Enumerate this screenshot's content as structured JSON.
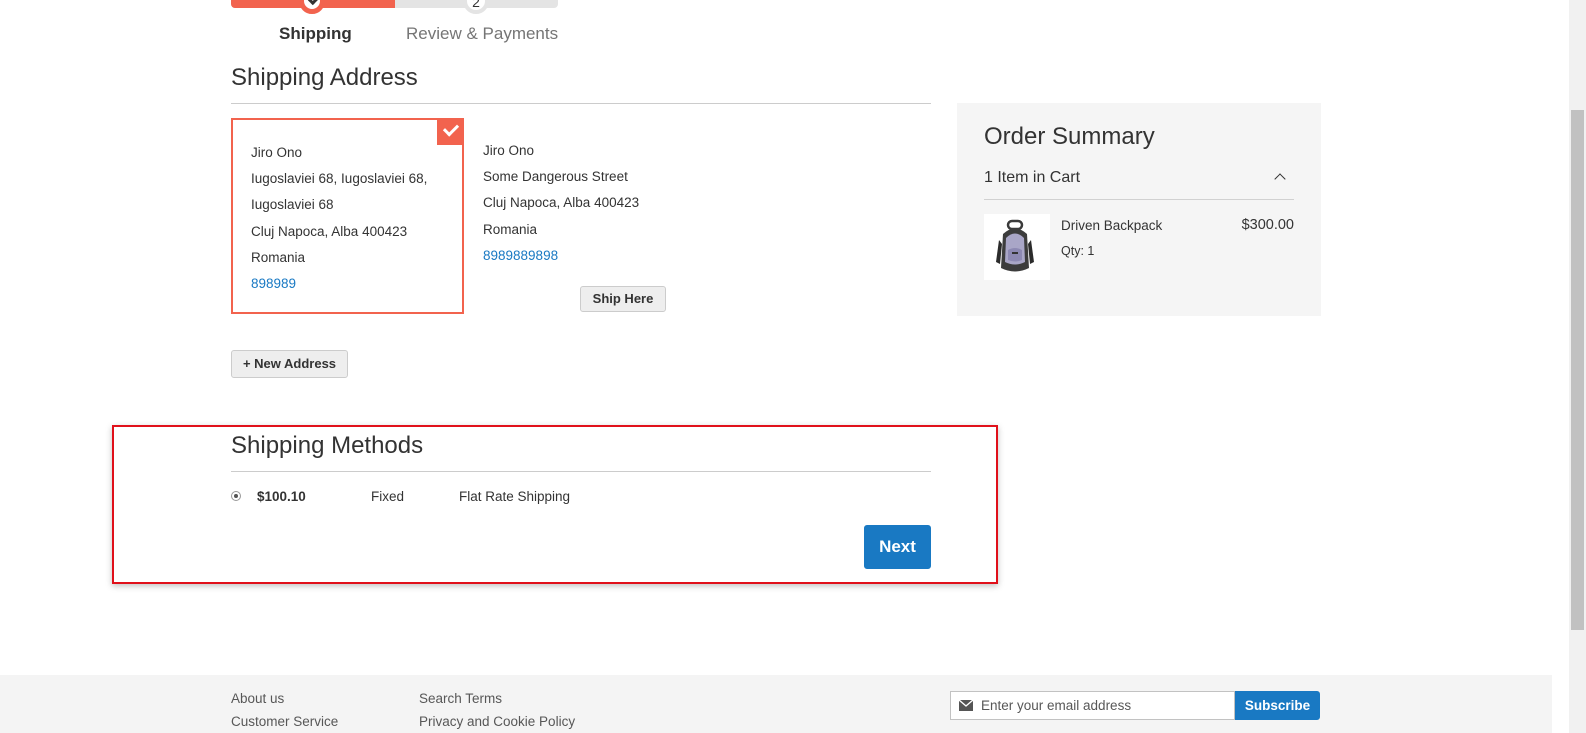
{
  "progress": {
    "fraction": 0.5,
    "steps": [
      {
        "number": "",
        "label": "Shipping",
        "state": "complete"
      },
      {
        "number": "2",
        "label": "Review & Payments",
        "state": "pending"
      }
    ]
  },
  "shipping_address": {
    "title": "Shipping Address",
    "addresses": [
      {
        "selected": true,
        "name": "Jiro Ono",
        "street_line1": "Iugoslaviei 68, Iugoslaviei 68,",
        "street_line2": "Iugoslaviei 68",
        "city_region_zip": "Cluj Napoca, Alba 400423",
        "country": "Romania",
        "phone": "898989"
      },
      {
        "selected": false,
        "name": "Jiro Ono",
        "street_line1": "Some Dangerous Street",
        "city_region_zip": "Cluj Napoca, Alba 400423",
        "country": "Romania",
        "phone": "8989889898",
        "ship_here_label": "Ship Here"
      }
    ],
    "new_address_label": "+ New Address"
  },
  "order_summary": {
    "title": "Order Summary",
    "items_in_cart": "1 Item in Cart",
    "items": [
      {
        "name": "Driven Backpack",
        "qty": "Qty: 1",
        "price": "$300.00",
        "image_icon": "backpack-image"
      }
    ]
  },
  "shipping_methods": {
    "title": "Shipping Methods",
    "options": [
      {
        "selected": true,
        "price": "$100.10",
        "method": "Fixed",
        "carrier": "Flat Rate Shipping"
      }
    ],
    "next_label": "Next"
  },
  "footer": {
    "links_col1": [
      "About us",
      "Customer Service"
    ],
    "links_col2": [
      "Search Terms",
      "Privacy and Cookie Policy"
    ],
    "newsletter": {
      "placeholder": "Enter your email address",
      "subscribe_label": "Subscribe"
    }
  },
  "colors": {
    "accent": "#f2634e",
    "primary": "#1979c3",
    "highlight": "#e0101a"
  }
}
